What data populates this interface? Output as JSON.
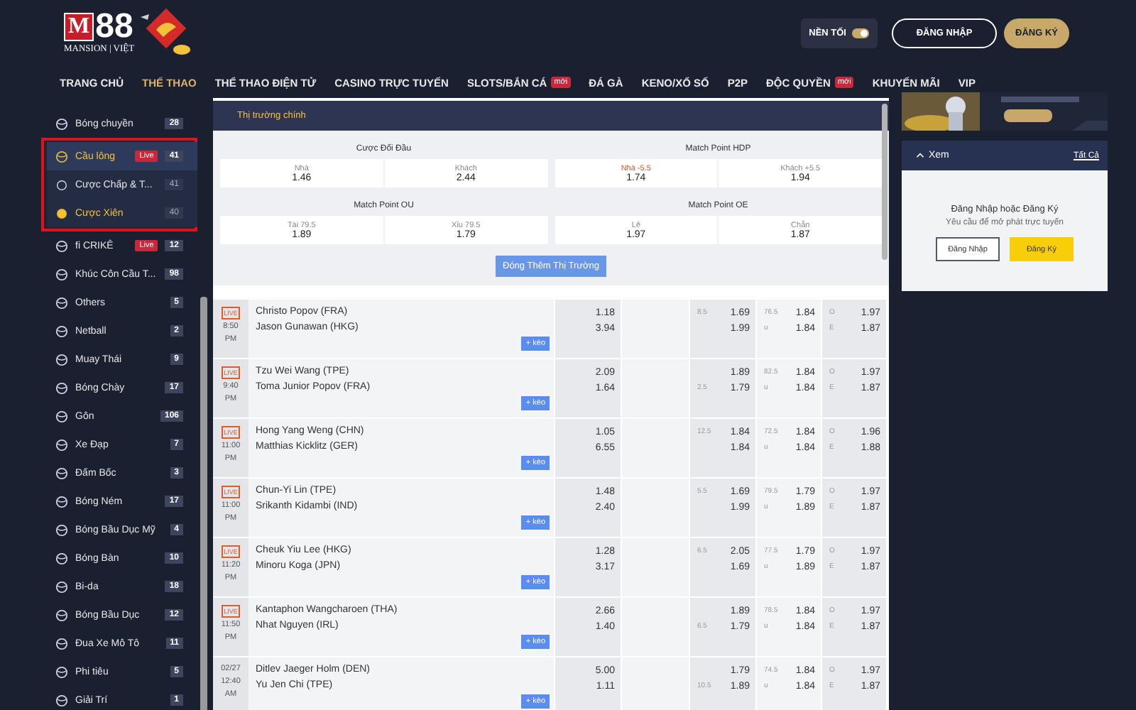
{
  "header": {
    "logo": {
      "mark": "M",
      "digits": "88",
      "tagline": "MANSION | VIỆT"
    },
    "theme_toggle": {
      "label": "NỀN TỐI",
      "on": true
    },
    "login_button": "ĐĂNG NHẬP",
    "register_button": "ĐĂNG KÝ"
  },
  "nav": [
    {
      "label": "TRANG CHỦ",
      "selected": false
    },
    {
      "label": "THỂ THAO",
      "selected": true
    },
    {
      "label": "THỂ THAO ĐIỆN TỬ",
      "selected": false
    },
    {
      "label": "CASINO TRỰC TUYẾN",
      "selected": false
    },
    {
      "label": "SLOTS/BẮN CÁ",
      "selected": false,
      "badge": "mới"
    },
    {
      "label": "ĐÁ GÀ",
      "selected": false
    },
    {
      "label": "KENO/XỔ SỐ",
      "selected": false
    },
    {
      "label": "P2P",
      "selected": false
    },
    {
      "label": "ĐỘC QUYỀN",
      "selected": false,
      "badge": "mới"
    },
    {
      "label": "KHUYẾN MÃI",
      "selected": false
    },
    {
      "label": "VIP",
      "selected": false
    }
  ],
  "sidebar": {
    "sports": [
      {
        "name": "Bóng chuyền",
        "count": "28",
        "selected": false
      },
      {
        "name": "Cầu lông",
        "count": "41",
        "selected": true,
        "badge": "Live",
        "children": [
          {
            "name": "Cược Chấp & T...",
            "count": "41",
            "selected": false
          },
          {
            "name": "Cược Xiên",
            "count": "40",
            "selected": true
          }
        ]
      },
      {
        "name": "fi CRIKÊ",
        "count": "12",
        "selected": false,
        "badge": "Live"
      },
      {
        "name": "Khúc Côn Cầu T...",
        "count": "98",
        "selected": false
      },
      {
        "name": "Others",
        "count": "5",
        "selected": false
      },
      {
        "name": "Netball",
        "count": "2",
        "selected": false
      },
      {
        "name": "Muay Thái",
        "count": "9",
        "selected": false
      },
      {
        "name": "Bóng Chày",
        "count": "17",
        "selected": false
      },
      {
        "name": "Gôn",
        "count": "106",
        "selected": false
      },
      {
        "name": "Xe Đạp",
        "count": "7",
        "selected": false
      },
      {
        "name": "Đấm Bốc",
        "count": "3",
        "selected": false
      },
      {
        "name": "Bóng Ném",
        "count": "17",
        "selected": false
      },
      {
        "name": "Bóng Bầu Dục Mỹ",
        "count": "4",
        "selected": false
      },
      {
        "name": "Bóng Bàn",
        "count": "10",
        "selected": false
      },
      {
        "name": "Bi-da",
        "count": "18",
        "selected": false
      },
      {
        "name": "Bóng Bầu Dục",
        "count": "12",
        "selected": false
      },
      {
        "name": "Đua Xe Mô Tô",
        "count": "11",
        "selected": false
      },
      {
        "name": "Phi tiêu",
        "count": "5",
        "selected": false
      },
      {
        "name": "Giải Trí",
        "count": "1",
        "selected": false
      }
    ]
  },
  "markets_panel": {
    "title": "Thị trường chính",
    "markets": [
      {
        "title": "Cược Đối Đầu",
        "options": [
          {
            "label": "Nhà",
            "odds": "1.46",
            "highlighted": false
          },
          {
            "label": "Khách",
            "odds": "2.44",
            "highlighted": false
          }
        ]
      },
      {
        "title": "Match Point HDP",
        "options": [
          {
            "label": "Nhà -5.5",
            "odds": "1.74",
            "highlighted": true
          },
          {
            "label": "Khách +5.5",
            "odds": "1.94",
            "highlighted": false
          }
        ]
      },
      {
        "title": "Match Point OU",
        "options": [
          {
            "label": "Tài 79.5",
            "odds": "1.89",
            "highlighted": false
          },
          {
            "label": "Xỉu 79.5",
            "odds": "1.79",
            "highlighted": false
          }
        ]
      },
      {
        "title": "Match Point OE",
        "options": [
          {
            "label": "Lẻ",
            "odds": "1.97",
            "highlighted": false
          },
          {
            "label": "Chẵn",
            "odds": "1.87",
            "highlighted": false
          }
        ]
      }
    ],
    "more_button": "Đóng Thêm Thị Trường"
  },
  "matches": [
    {
      "live_badge": "LIVE",
      "time": "8:50",
      "period": "PM",
      "teams": [
        "Christo Popov (FRA)",
        "Jason Gunawan (HKG)"
      ],
      "moneyline": [
        "1.18",
        "3.94"
      ],
      "handicap": [
        {
          "line": "8.5",
          "odds": "1.69"
        },
        {
          "odds": "1.99"
        }
      ],
      "over_under": [
        {
          "line": "76.5",
          "odds": "1.84"
        },
        {
          "label": "u",
          "odds": "1.84"
        }
      ],
      "odd_even": [
        {
          "label": "O",
          "odds": "1.97"
        },
        {
          "label": "E",
          "odds": "1.87"
        }
      ],
      "more_button": "+ kèo"
    },
    {
      "live_badge": "LIVE",
      "time": "9:40",
      "period": "PM",
      "teams": [
        "Tzu Wei Wang (TPE)",
        "Toma Junior Popov (FRA)"
      ],
      "moneyline": [
        "2.09",
        "1.64"
      ],
      "handicap": [
        {
          "odds": "1.89"
        },
        {
          "line": "2.5",
          "odds": "1.79"
        }
      ],
      "over_under": [
        {
          "line": "82.5",
          "odds": "1.84"
        },
        {
          "label": "u",
          "odds": "1.84"
        }
      ],
      "odd_even": [
        {
          "label": "O",
          "odds": "1.97"
        },
        {
          "label": "E",
          "odds": "1.87"
        }
      ],
      "more_button": "+ kèo"
    },
    {
      "live_badge": "LIVE",
      "time": "11:00",
      "period": "PM",
      "teams": [
        "Hong Yang Weng (CHN)",
        "Matthias Kicklitz (GER)"
      ],
      "moneyline": [
        "1.05",
        "6.55"
      ],
      "handicap": [
        {
          "line": "12.5",
          "odds": "1.84"
        },
        {
          "odds": "1.84"
        }
      ],
      "over_under": [
        {
          "line": "72.5",
          "odds": "1.84"
        },
        {
          "label": "u",
          "odds": "1.84"
        }
      ],
      "odd_even": [
        {
          "label": "O",
          "odds": "1.96"
        },
        {
          "label": "E",
          "odds": "1.88"
        }
      ],
      "more_button": "+ kèo"
    },
    {
      "live_badge": "LIVE",
      "time": "11:00",
      "period": "PM",
      "teams": [
        "Chun-Yi Lin (TPE)",
        "Srikanth Kidambi (IND)"
      ],
      "moneyline": [
        "1.48",
        "2.40"
      ],
      "handicap": [
        {
          "line": "5.5",
          "odds": "1.69"
        },
        {
          "odds": "1.99"
        }
      ],
      "over_under": [
        {
          "line": "79.5",
          "odds": "1.79"
        },
        {
          "label": "u",
          "odds": "1.89"
        }
      ],
      "odd_even": [
        {
          "label": "O",
          "odds": "1.97"
        },
        {
          "label": "E",
          "odds": "1.87"
        }
      ],
      "more_button": "+ kèo"
    },
    {
      "live_badge": "LIVE",
      "time": "11:20",
      "period": "PM",
      "teams": [
        "Cheuk Yiu Lee (HKG)",
        "Minoru Koga (JPN)"
      ],
      "moneyline": [
        "1.28",
        "3.17"
      ],
      "handicap": [
        {
          "line": "6.5",
          "odds": "2.05"
        },
        {
          "odds": "1.69"
        }
      ],
      "over_under": [
        {
          "line": "77.5",
          "odds": "1.79"
        },
        {
          "label": "u",
          "odds": "1.89"
        }
      ],
      "odd_even": [
        {
          "label": "O",
          "odds": "1.97"
        },
        {
          "label": "E",
          "odds": "1.87"
        }
      ],
      "more_button": "+ kèo"
    },
    {
      "live_badge": "LIVE",
      "time": "11:50",
      "period": "PM",
      "teams": [
        "Kantaphon Wangcharoen (THA)",
        "Nhat Nguyen (IRL)"
      ],
      "moneyline": [
        "2.66",
        "1.40"
      ],
      "handicap": [
        {
          "odds": "1.89"
        },
        {
          "line": "6.5",
          "odds": "1.79"
        }
      ],
      "over_under": [
        {
          "line": "78.5",
          "odds": "1.84"
        },
        {
          "label": "u",
          "odds": "1.84"
        }
      ],
      "odd_even": [
        {
          "label": "O",
          "odds": "1.97"
        },
        {
          "label": "E",
          "odds": "1.87"
        }
      ],
      "more_button": "+ kèo"
    },
    {
      "date": "02/27",
      "time": "12:40",
      "period": "AM",
      "teams": [
        "Ditlev Jaeger Holm (DEN)",
        "Yu Jen Chi (TPE)"
      ],
      "moneyline": [
        "5.00",
        "1.11"
      ],
      "handicap": [
        {
          "odds": "1.79"
        },
        {
          "line": "10.5",
          "odds": "1.89"
        }
      ],
      "over_under": [
        {
          "line": "74.5",
          "odds": "1.84"
        },
        {
          "label": "u",
          "odds": "1.84"
        }
      ],
      "odd_even": [
        {
          "label": "O",
          "odds": "1.97"
        },
        {
          "label": "E",
          "odds": "1.87"
        }
      ],
      "more_button": "+ kèo"
    }
  ],
  "right_panel": {
    "section": {
      "title": "Xem",
      "expanded": true,
      "all_link": "Tất Cả"
    },
    "login_prompt": {
      "title": "Đăng Nhập hoặc Đăng Ký",
      "subtitle": "Yêu cầu để mở phát trực tuyến",
      "login_button": "Đăng Nhập",
      "register_button": "Đăng Ký"
    }
  }
}
